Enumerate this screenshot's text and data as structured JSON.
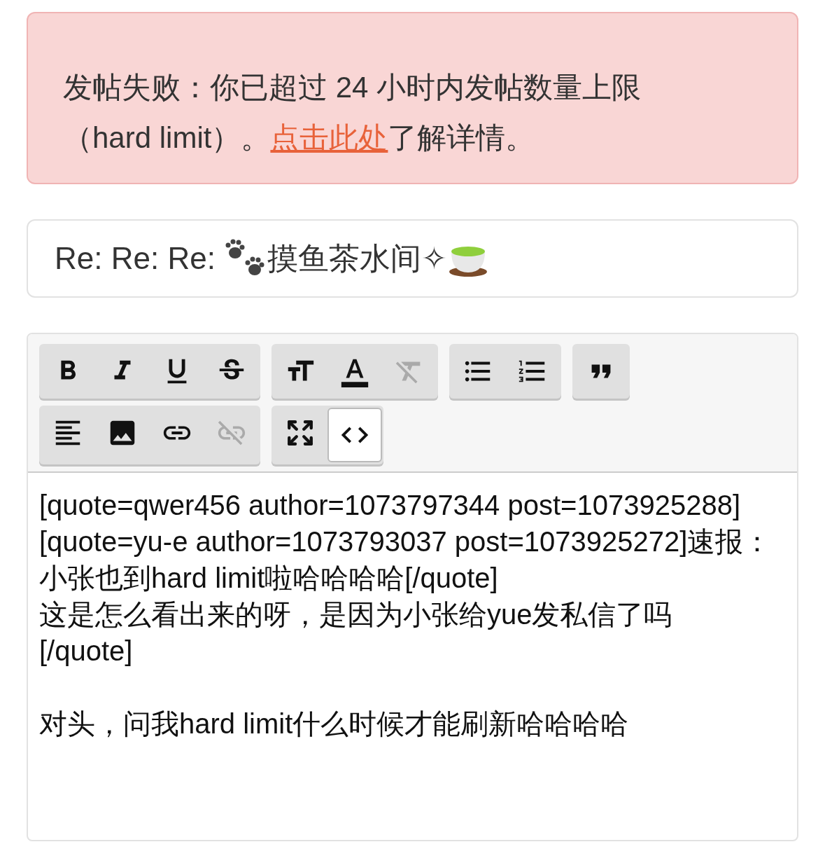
{
  "error_banner": {
    "before": "发帖失败：你已超过 24 小时内发帖数量上限（hard limit）。",
    "link": "点击此处",
    "after": "了解详情。"
  },
  "title_field": {
    "segments": [
      {
        "kind": "text",
        "text": "Re: Re: Re: "
      },
      {
        "kind": "paw"
      },
      {
        "kind": "text",
        "text": "摸鱼茶水间✧"
      },
      {
        "kind": "tea"
      }
    ]
  },
  "toolbar": {
    "rows": [
      [
        [
          {
            "kind": "bold",
            "disabled": false,
            "selected": false
          },
          {
            "kind": "italic",
            "disabled": false,
            "selected": false
          },
          {
            "kind": "underline",
            "disabled": false,
            "selected": false
          },
          {
            "kind": "strikethrough",
            "disabled": false,
            "selected": false
          }
        ],
        [
          {
            "kind": "size",
            "disabled": false,
            "selected": false
          },
          {
            "kind": "color",
            "disabled": false,
            "selected": false
          },
          {
            "kind": "clear",
            "disabled": true,
            "selected": false
          }
        ],
        [
          {
            "kind": "bullets",
            "disabled": false,
            "selected": false
          },
          {
            "kind": "numbers",
            "disabled": false,
            "selected": false
          }
        ],
        [
          {
            "kind": "quote",
            "disabled": false,
            "selected": false
          }
        ]
      ],
      [
        [
          {
            "kind": "align",
            "disabled": false,
            "selected": false
          },
          {
            "kind": "image",
            "disabled": false,
            "selected": false
          },
          {
            "kind": "link",
            "disabled": false,
            "selected": false
          },
          {
            "kind": "unlink",
            "disabled": true,
            "selected": false
          }
        ],
        [
          {
            "kind": "maximize",
            "disabled": false,
            "selected": false
          },
          {
            "kind": "source",
            "disabled": false,
            "selected": true
          }
        ]
      ]
    ]
  },
  "editor": {
    "value": "[quote=qwer456 author=1073797344 post=1073925288][quote=yu-e author=1073793037 post=1073925272]速报：小张也到hard limit啦哈哈哈哈[/quote]\n这是怎么看出来的呀，是因为小张给yue发私信了吗\n[/quote]\n\n对头，问我hard limit什么时候才能刷新哈哈哈哈"
  }
}
